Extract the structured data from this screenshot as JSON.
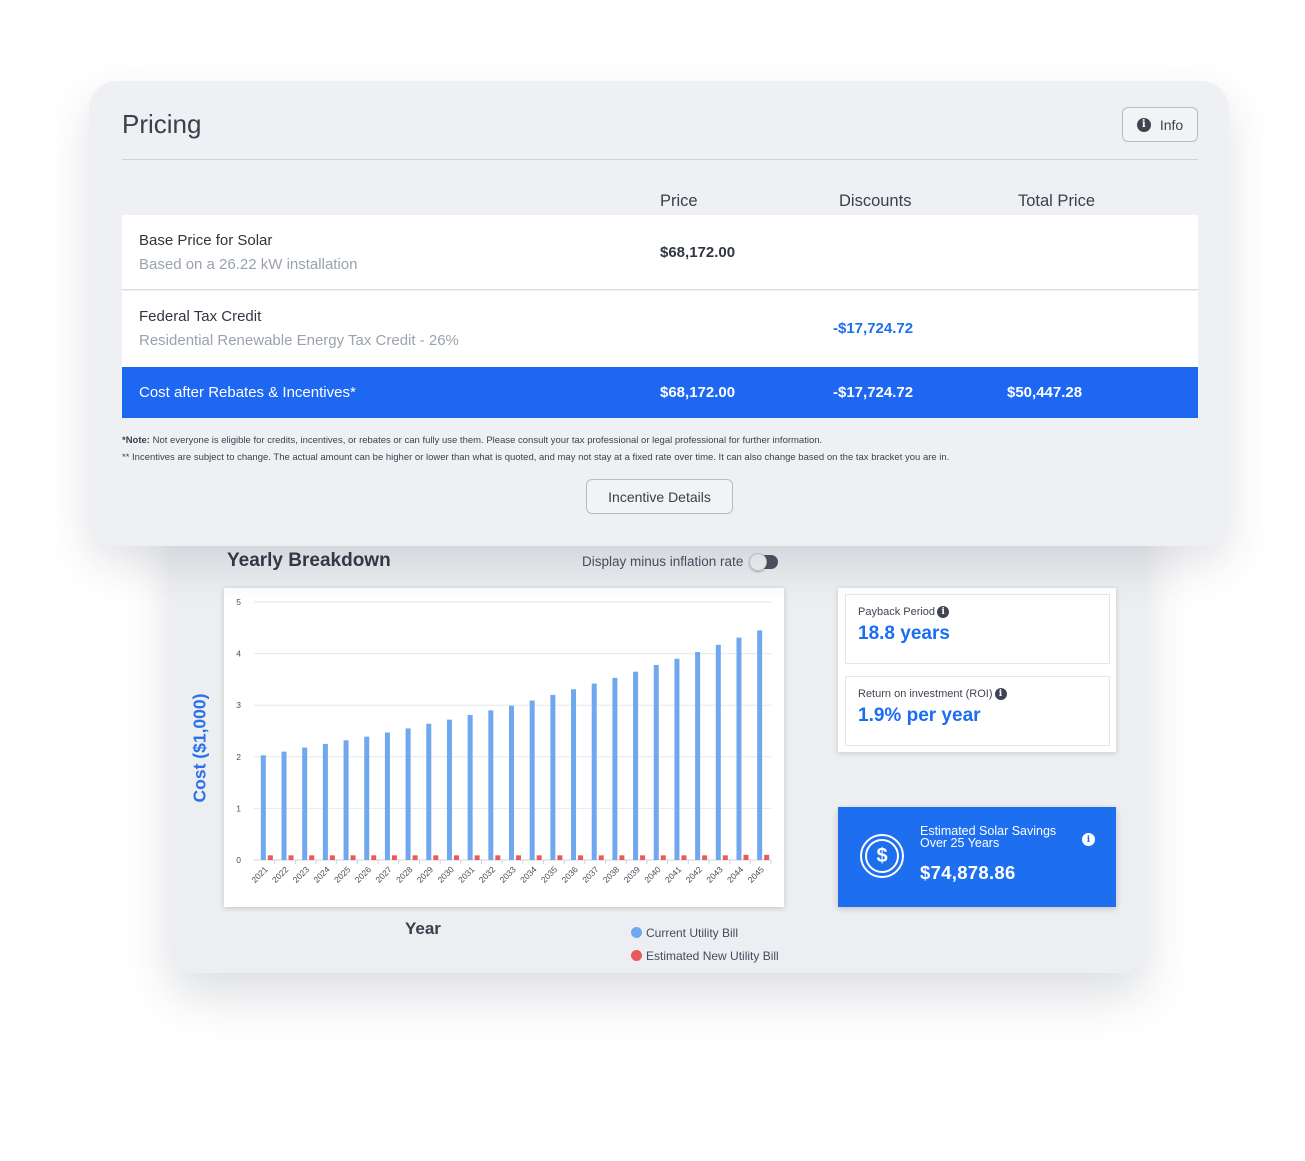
{
  "pricing": {
    "title": "Pricing",
    "info_label": "Info",
    "columns": {
      "price": "Price",
      "discounts": "Discounts",
      "total": "Total Price"
    },
    "rows": [
      {
        "title": "Base Price for Solar",
        "subtitle": "Based on a 26.22 kW installation",
        "price": "$68,172.00",
        "discount": ""
      },
      {
        "title": "Federal Tax Credit",
        "subtitle": "Residential Renewable Energy Tax Credit - 26%",
        "price": "",
        "discount": "-$17,724.72"
      }
    ],
    "total_row": {
      "label": "Cost after Rebates & Incentives*",
      "price": "$68,172.00",
      "discount": "-$17,724.72",
      "total": "$50,447.28"
    },
    "note_1_bold": "*Note:",
    "note_1_text": " Not everyone is eligible for credits, incentives, or rebates or can fully use them. Please consult your tax professional or legal professional for further information.",
    "note_2": "** Incentives are subject to change. The actual amount can be higher or lower than what is quoted, and may not stay at a fixed rate over time. It can also change based on the tax bracket you are in.",
    "incentive_button": "Incentive Details"
  },
  "breakdown": {
    "title": "Yearly Breakdown",
    "toggle_label": "Display minus inflation rate",
    "toggle_on": false,
    "payback_label": "Payback Period",
    "payback_value": "18.8 years",
    "roi_label": "Return on investment (ROI)",
    "roi_value": "1.9% per year",
    "savings_label_1": "Estimated Solar Savings",
    "savings_label_2": "Over 25 Years",
    "savings_value": "$74,878.86"
  },
  "colors": {
    "accent": "#1d67f3",
    "current_bill": "#6fa8ee",
    "new_bill": "#ea5a5a"
  },
  "icons": [
    "info-icon",
    "dollar-circle-icon"
  ],
  "chart_data": {
    "type": "bar",
    "title": "",
    "xlabel": "Year",
    "ylabel": "Cost ($1,000)",
    "ylim": [
      0,
      5
    ],
    "yticks": [
      0,
      1,
      2,
      3,
      4,
      5
    ],
    "grid": true,
    "categories": [
      "2021",
      "2022",
      "2023",
      "2024",
      "2025",
      "2026",
      "2027",
      "2028",
      "2029",
      "2030",
      "2031",
      "2032",
      "2033",
      "2034",
      "2035",
      "2036",
      "2037",
      "2038",
      "2039",
      "2040",
      "2041",
      "2042",
      "2043",
      "2044",
      "2045"
    ],
    "series": [
      {
        "name": "Current Utility Bill",
        "values": [
          2.03,
          2.1,
          2.18,
          2.25,
          2.32,
          2.39,
          2.47,
          2.55,
          2.64,
          2.72,
          2.81,
          2.9,
          2.99,
          3.09,
          3.2,
          3.31,
          3.42,
          3.53,
          3.65,
          3.78,
          3.9,
          4.03,
          4.17,
          4.31,
          4.45
        ]
      },
      {
        "name": "Estimated New Utility Bill",
        "values": [
          0.09,
          0.09,
          0.09,
          0.09,
          0.09,
          0.09,
          0.09,
          0.09,
          0.09,
          0.09,
          0.09,
          0.09,
          0.09,
          0.09,
          0.09,
          0.09,
          0.09,
          0.09,
          0.09,
          0.09,
          0.09,
          0.09,
          0.09,
          0.1,
          0.1
        ]
      }
    ],
    "legend": "bottom-right"
  }
}
